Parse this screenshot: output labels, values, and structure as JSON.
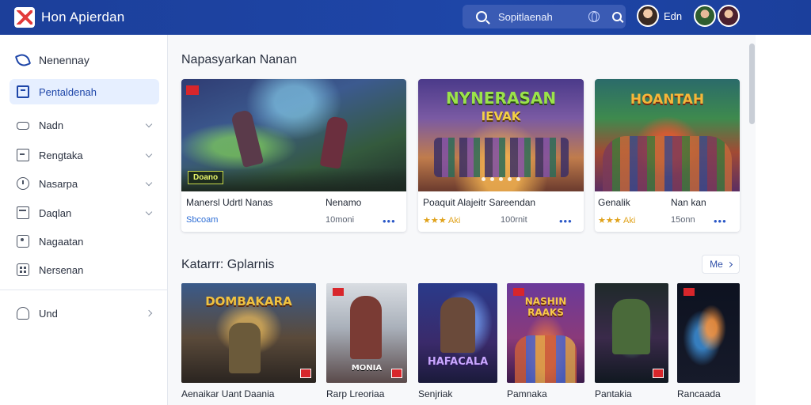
{
  "app": {
    "title": "Hon Apierdan"
  },
  "search": {
    "placeholder": "Sopitlaenah"
  },
  "user": {
    "name": "Edn"
  },
  "sidebar": {
    "items": [
      {
        "label": "Nenennay",
        "icon": "leaf-icon"
      },
      {
        "label": "Pentaldenah",
        "icon": "square-icon",
        "active": true
      },
      {
        "label": "Nadn",
        "icon": "gamepad-icon"
      },
      {
        "label": "Rengtaka",
        "icon": "list-icon"
      },
      {
        "label": "Nasarpa",
        "icon": "clock-icon"
      },
      {
        "label": "Daqlan",
        "icon": "calendar-icon"
      },
      {
        "label": "Nagaatan",
        "icon": "people-icon"
      },
      {
        "label": "Nersenan",
        "icon": "grid-icon"
      },
      {
        "label": "Und",
        "icon": "user-icon"
      }
    ]
  },
  "featured": {
    "title": "Napasyarkan Nanan",
    "cards": [
      {
        "title": "Manersl Udrtl Nanas",
        "title2": "Nenamo",
        "meta": "Sbcoam",
        "meta2": "10moni",
        "art_label": "Doano"
      },
      {
        "title": "Poaquit Alajeitr Sareendan",
        "meta": "★★★ Aki",
        "meta2": "100rnit",
        "art_title": "NYNERASAN",
        "art_subtitle": "IEVAK"
      },
      {
        "title": "Genalik",
        "title2": "Nan kan",
        "meta": "★★★ Aki",
        "meta2": "15onn",
        "art_title": "HOANTAH"
      }
    ]
  },
  "category": {
    "title": "Katarrr: Gplarnis",
    "more_label": "Me",
    "items": [
      {
        "label": "Aenaikar Uant Daania",
        "art_title": "DOMBAKARA"
      },
      {
        "label": "Rarp Lreoriaa",
        "art_title": "MONIA"
      },
      {
        "label": "Senjriak",
        "art_title": "HAFACALA"
      },
      {
        "label": "Pamnaka",
        "art_title": "NASHIN RAAKS"
      },
      {
        "label": "Pantakia"
      },
      {
        "label": "Rancaada"
      }
    ]
  }
}
